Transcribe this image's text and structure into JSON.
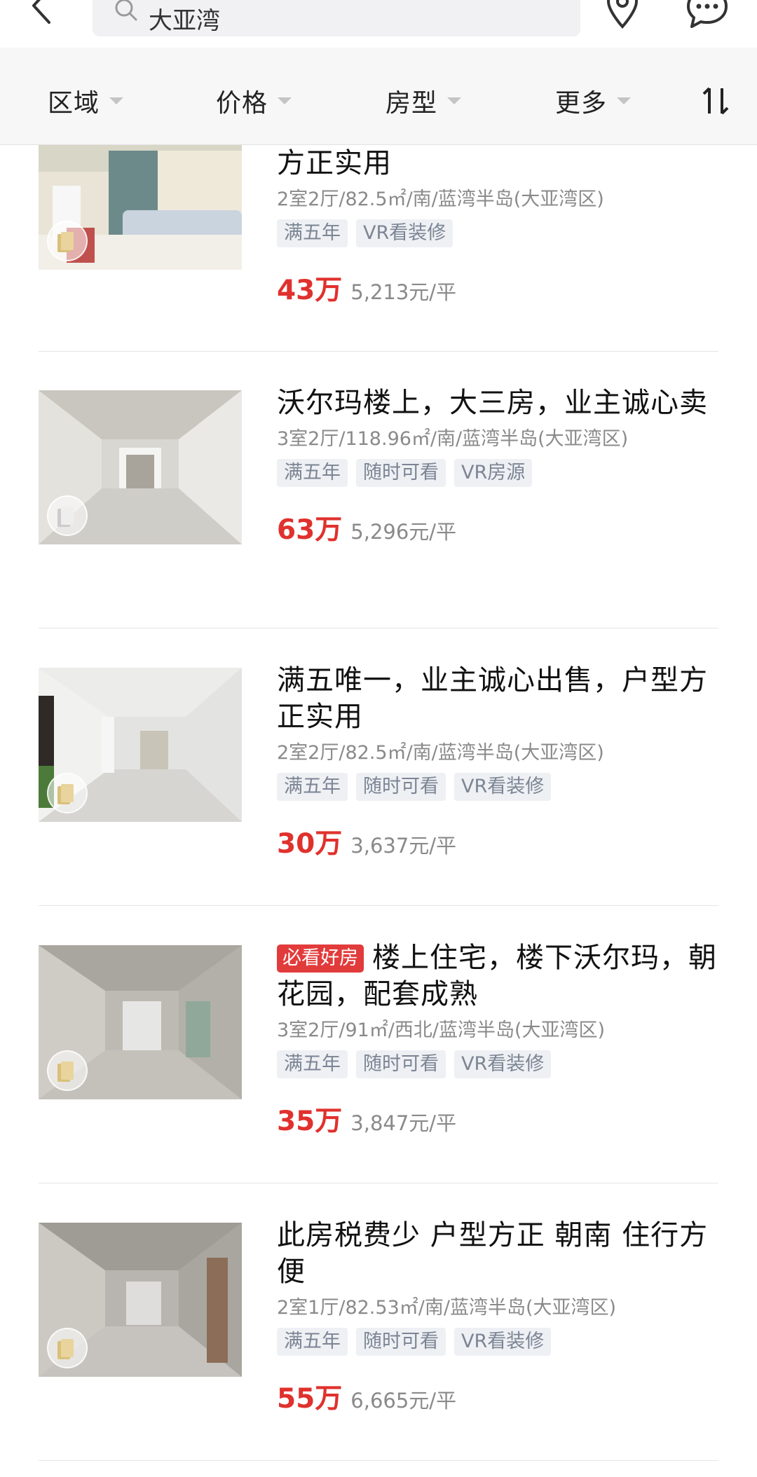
{
  "search": {
    "query": "大亚湾"
  },
  "filters": [
    {
      "label": "区域"
    },
    {
      "label": "价格"
    },
    {
      "label": "房型"
    },
    {
      "label": "更多"
    }
  ],
  "listings": [
    {
      "title": "方正实用",
      "badge": "",
      "meta": "2室2厅/82.5㎡/南/蓝湾半岛(大亚湾区)",
      "tags": [
        "满五年",
        "VR看装修"
      ],
      "price": "43万",
      "unit_price": "5,213元/平"
    },
    {
      "title": "沃尔玛楼上，大三房，业主诚心卖",
      "badge": "",
      "meta": "3室2厅/118.96㎡/南/蓝湾半岛(大亚湾区)",
      "tags": [
        "满五年",
        "随时可看",
        "VR房源"
      ],
      "price": "63万",
      "unit_price": "5,296元/平"
    },
    {
      "title": "满五唯一，业主诚心出售，户型方正实用",
      "badge": "",
      "meta": "2室2厅/82.5㎡/南/蓝湾半岛(大亚湾区)",
      "tags": [
        "满五年",
        "随时可看",
        "VR看装修"
      ],
      "price": "30万",
      "unit_price": "3,637元/平"
    },
    {
      "title": "楼上住宅，楼下沃尔玛，朝花园，配套成熟",
      "badge": "必看好房",
      "meta": "3室2厅/91㎡/西北/蓝湾半岛(大亚湾区)",
      "tags": [
        "满五年",
        "随时可看",
        "VR看装修"
      ],
      "price": "35万",
      "unit_price": "3,847元/平"
    },
    {
      "title": "此房税费少 户型方正 朝南 住行方便",
      "badge": "",
      "meta": "2室1厅/82.53㎡/南/蓝湾半岛(大亚湾区)",
      "tags": [
        "满五年",
        "随时可看",
        "VR看装修"
      ],
      "price": "55万",
      "unit_price": "6,665元/平"
    }
  ]
}
